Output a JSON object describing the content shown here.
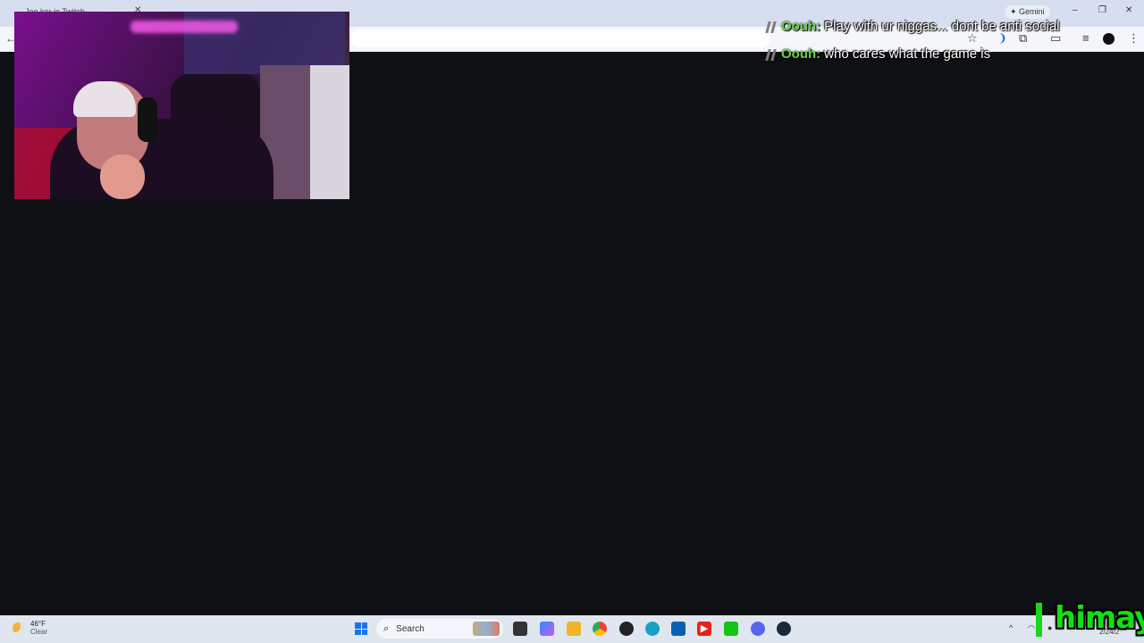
{
  "browser": {
    "tab_title": "Joe ker in Twitch",
    "tab_close": "✕",
    "back": "←",
    "gemini_label": "Gemini",
    "window_controls": [
      "–",
      "❐",
      "✕"
    ],
    "toolbar_icons": [
      "star-icon",
      "read-aloud-icon",
      "extensions-icon",
      "cast-icon",
      "tab-search-icon",
      "profile-icon",
      "menu-icon"
    ]
  },
  "chat": [
    {
      "user": "Oouh:",
      "message": "Play with ur niggas... dont be anti social"
    },
    {
      "user": "Oouh:",
      "message": "who cares what the game is"
    }
  ],
  "taskbar": {
    "weather_temp": "46°F",
    "weather_cond": "Clear",
    "search_label": "Search",
    "date": "2/24/2"
  },
  "overlay": {
    "logo_text": "himay"
  },
  "colors": {
    "chat_user": "#6bd24b",
    "logo": "#12e012",
    "background": "#0f1013"
  }
}
